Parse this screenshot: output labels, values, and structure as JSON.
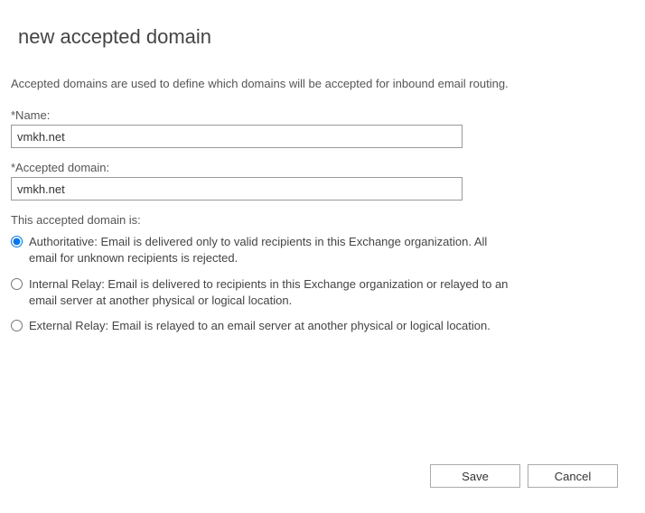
{
  "title": "new accepted domain",
  "description": "Accepted domains are used to define which domains will be accepted for inbound email routing.",
  "fields": {
    "name": {
      "label": "*Name:",
      "value": "vmkh.net"
    },
    "acceptedDomain": {
      "label": "*Accepted domain:",
      "value": "vmkh.net"
    }
  },
  "radioSection": {
    "heading": "This accepted domain is:",
    "options": [
      {
        "label": "Authoritative: Email is delivered only to valid recipients in this Exchange organization. All email for unknown recipients is rejected.",
        "checked": true
      },
      {
        "label": "Internal Relay: Email is delivered to recipients in this Exchange organization or relayed to an email server at another physical or logical location.",
        "checked": false
      },
      {
        "label": "External Relay: Email is relayed to an email server at another physical or logical location.",
        "checked": false
      }
    ]
  },
  "buttons": {
    "save": "Save",
    "cancel": "Cancel"
  }
}
